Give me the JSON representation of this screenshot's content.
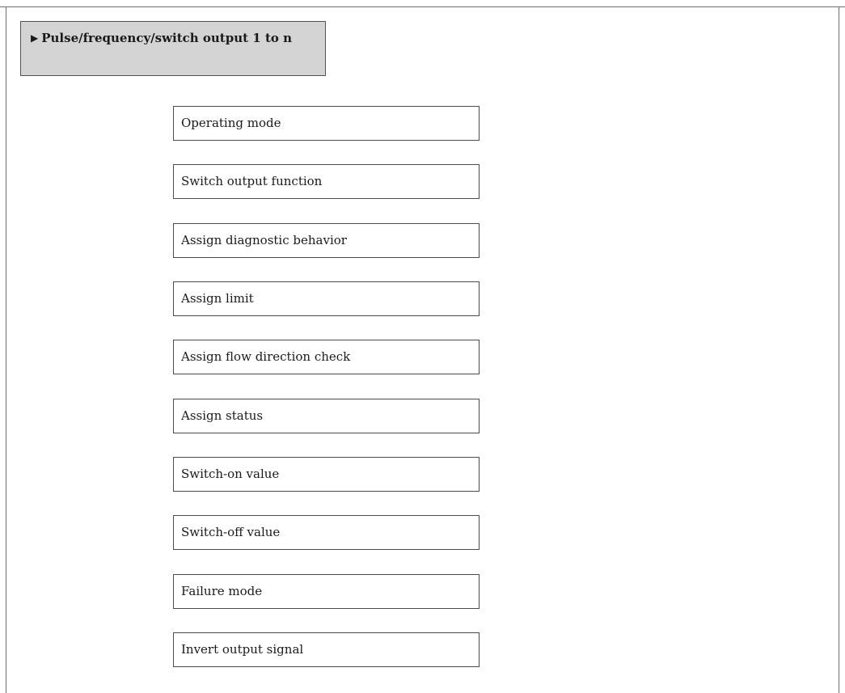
{
  "menu": {
    "arrow": "▶",
    "title": "Pulse/frequency/switch output 1 to n"
  },
  "parameters": [
    "Operating mode",
    "Switch output function",
    "Assign diagnostic behavior",
    "Assign limit",
    "Assign flow direction check",
    "Assign status",
    "Switch-on value",
    "Switch-off value",
    "Failure mode",
    "Invert output signal"
  ]
}
